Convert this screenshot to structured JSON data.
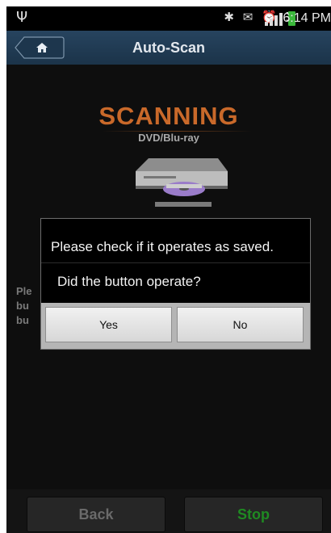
{
  "status_bar": {
    "time": "6:14 PM"
  },
  "header": {
    "title": "Auto-Scan"
  },
  "scan": {
    "heading": "SCANNING",
    "device_type": "DVD/Blu-ray",
    "instructions": [
      "Ple",
      "bu",
      "bu"
    ]
  },
  "dialog": {
    "title": "Please check if it operates as saved.",
    "message": "Did the button operate?",
    "yes_label": "Yes",
    "no_label": "No"
  },
  "footer": {
    "back_label": "Back",
    "stop_label": "Stop"
  },
  "colors": {
    "accent_orange": "#c9692a",
    "stop_green": "#1f8a22",
    "header_blue": "#1f3a55",
    "battery_green": "#3bb83b"
  }
}
